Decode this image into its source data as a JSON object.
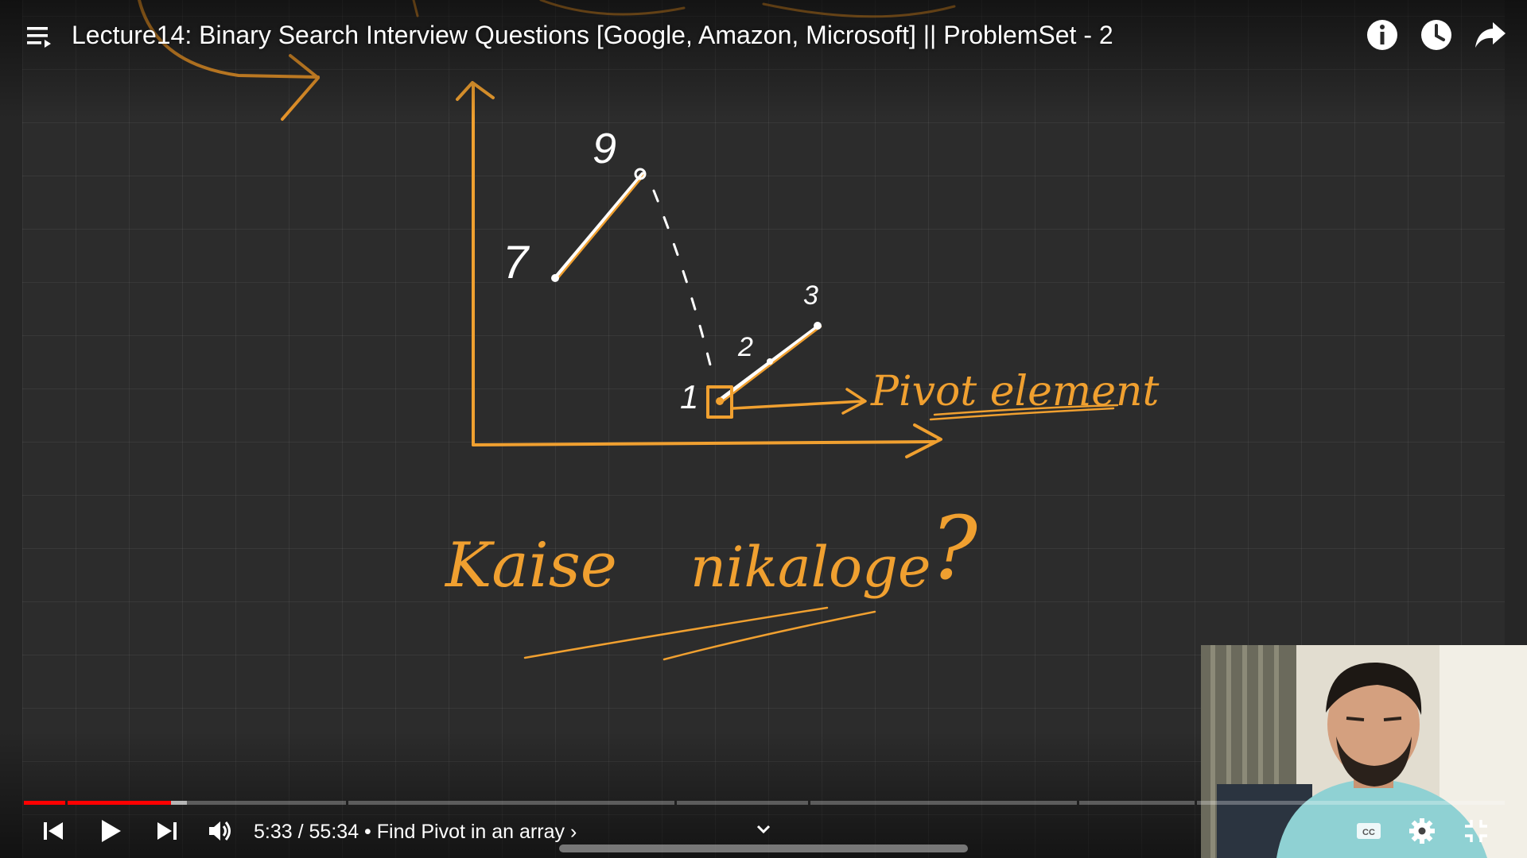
{
  "header": {
    "title": "Lecture14: Binary Search Interview Questions [Google, Amazon, Microsoft] || ProblemSet - 2",
    "buttons": [
      {
        "name": "info-icon"
      },
      {
        "name": "watch-later-icon"
      },
      {
        "name": "share-icon"
      }
    ]
  },
  "whiteboard": {
    "point_labels": [
      "9",
      "7",
      "3",
      "2",
      "1"
    ],
    "annotation": "Pivot element",
    "question_words": [
      "Kaise",
      "nikaloge",
      "?"
    ],
    "ink_color": "#f0a030",
    "chalk_color": "#ffffff"
  },
  "player": {
    "current_time": "5:33",
    "time_separator": "/",
    "duration": "55:34",
    "chapter_separator": "•",
    "chapter_title": "Find Pivot in an array",
    "chapter_arrow": "›",
    "progress_fraction": 0.1,
    "accent_color": "#ff0000",
    "controls": [
      "previous-icon",
      "play-icon",
      "next-icon",
      "volume-icon",
      "chevron-down-icon",
      "captions-icon",
      "settings-icon",
      "exit-fullscreen-icon"
    ]
  }
}
